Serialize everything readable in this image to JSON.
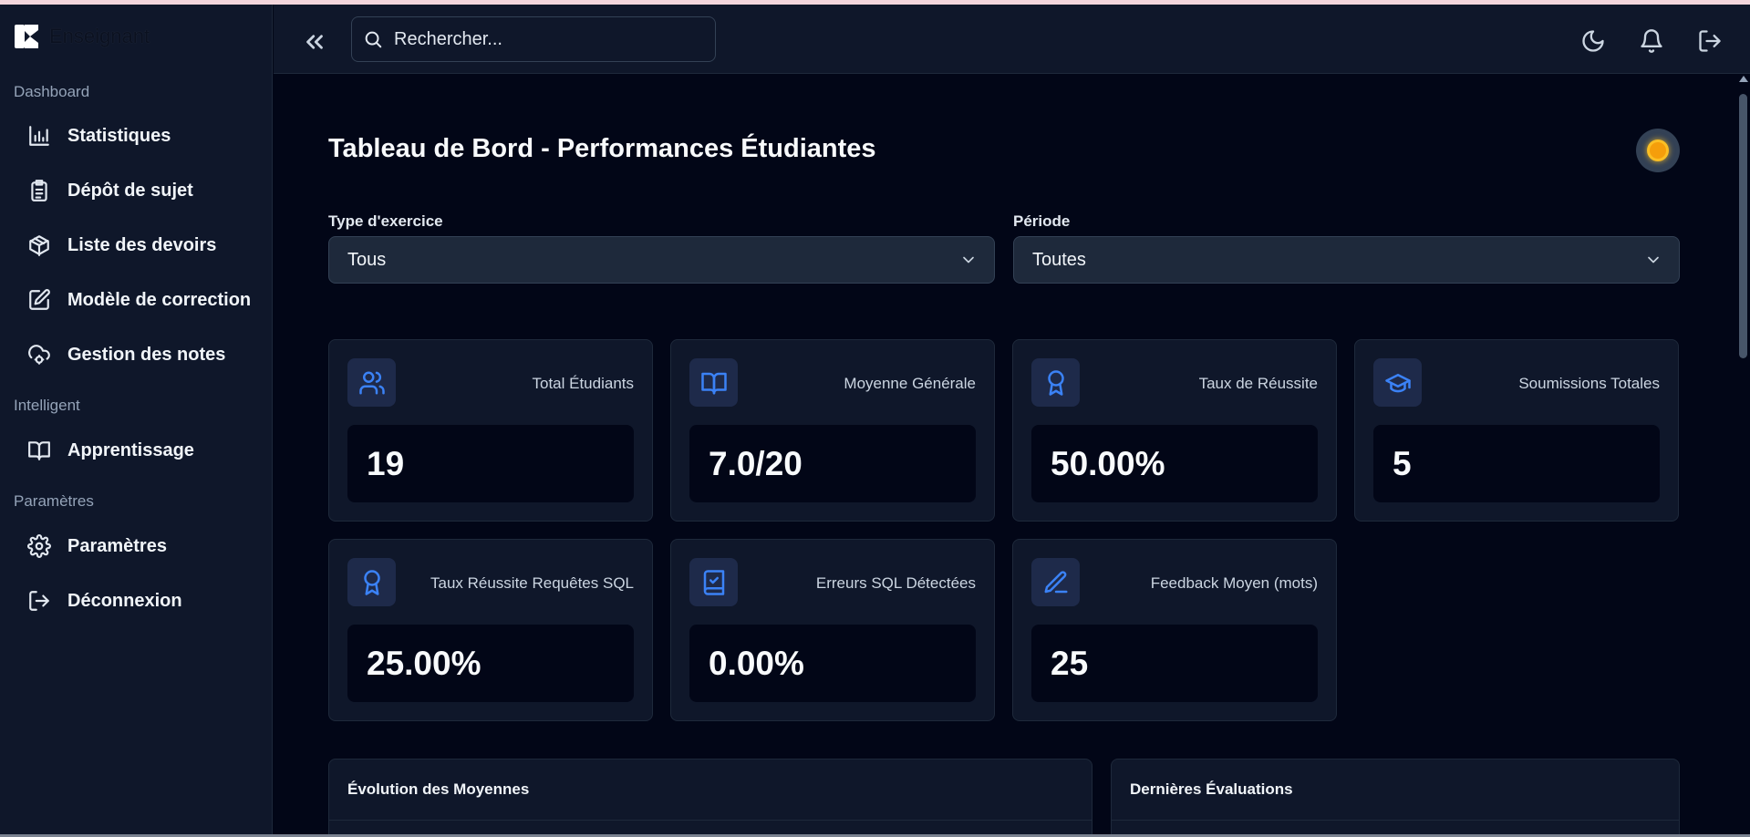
{
  "app": {
    "name": "Enseignant"
  },
  "sidebar": {
    "sections": [
      {
        "label": "Dashboard"
      },
      {
        "label": "Intelligent"
      },
      {
        "label": "Paramètres"
      }
    ],
    "items": [
      {
        "label": "Statistiques",
        "icon": "bar-chart-icon"
      },
      {
        "label": "Dépôt de sujet",
        "icon": "clipboard-icon"
      },
      {
        "label": "Liste des devoirs",
        "icon": "package-icon"
      },
      {
        "label": "Modèle de correction",
        "icon": "edit-icon"
      },
      {
        "label": "Gestion des notes",
        "icon": "cloud-cog-icon"
      },
      {
        "label": "Apprentissage",
        "icon": "book-open-icon"
      },
      {
        "label": "Paramètres",
        "icon": "gear-icon"
      },
      {
        "label": "Déconnexion",
        "icon": "logout-icon"
      }
    ]
  },
  "header": {
    "search_placeholder": "Rechercher...",
    "icons": [
      "collapse-icon",
      "moon-icon",
      "bell-icon",
      "logout-icon"
    ]
  },
  "main": {
    "title": "Tableau de Bord - Performances Étudiantes",
    "filters": {
      "type_label": "Type d'exercice",
      "type_value": "Tous",
      "period_label": "Période",
      "period_value": "Toutes"
    },
    "stats": [
      {
        "label": "Total Étudiants",
        "value": "19",
        "icon": "users-icon"
      },
      {
        "label": "Moyenne Générale",
        "value": "7.0/20",
        "icon": "book-open-icon"
      },
      {
        "label": "Taux de Réussite",
        "value": "50.00%",
        "icon": "award-icon"
      },
      {
        "label": "Soumissions Totales",
        "value": "5",
        "icon": "graduation-cap-icon"
      },
      {
        "label": "Taux Réussite Requêtes SQL",
        "value": "25.00%",
        "icon": "award-icon"
      },
      {
        "label": "Erreurs SQL Détectées",
        "value": "0.00%",
        "icon": "book-check-icon"
      },
      {
        "label": "Feedback Moyen (mots)",
        "value": "25",
        "icon": "pen-line-icon"
      }
    ],
    "panels": [
      {
        "title": "Évolution des Moyennes"
      },
      {
        "title": "Dernières Évaluations"
      }
    ]
  },
  "colors": {
    "accent": "#3b82f6",
    "background": "#020617",
    "surface": "#0f172a",
    "sun": "#f59e0b"
  }
}
